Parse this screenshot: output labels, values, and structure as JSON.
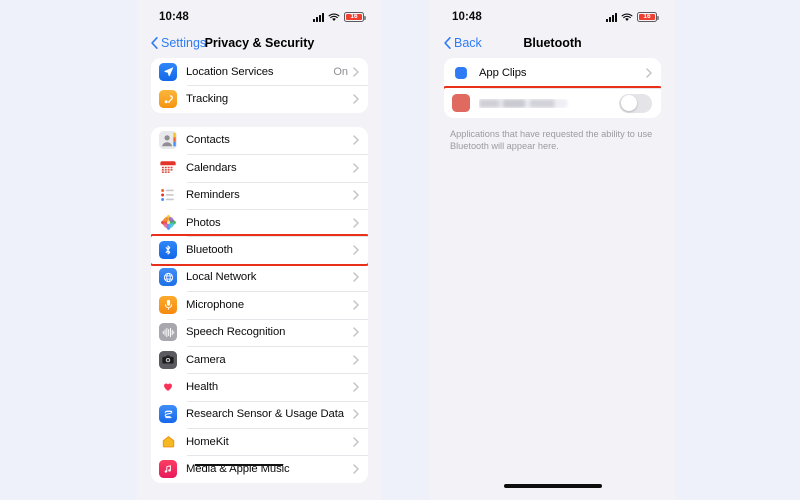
{
  "statusbar": {
    "time": "10:48",
    "battery_percent": "16",
    "cell_icon": "cellular-signal-icon",
    "wifi_icon": "wifi-icon",
    "battery_icon": "battery-low-icon"
  },
  "left_phone": {
    "nav": {
      "back_label": "Settings",
      "title": "Privacy & Security",
      "back_icon": "chevron-left-icon"
    },
    "group1": [
      {
        "label": "Location Services",
        "value": "On",
        "icon": "location-arrow-icon"
      },
      {
        "label": "Tracking",
        "value": "",
        "icon": "tracking-icon"
      }
    ],
    "group2": [
      {
        "label": "Contacts",
        "value": "",
        "icon": "contacts-icon"
      },
      {
        "label": "Calendars",
        "value": "",
        "icon": "calendar-icon"
      },
      {
        "label": "Reminders",
        "value": "",
        "icon": "reminders-icon"
      },
      {
        "label": "Photos",
        "value": "",
        "icon": "photos-icon"
      },
      {
        "label": "Bluetooth",
        "value": "",
        "icon": "bluetooth-icon",
        "highlighted": true
      },
      {
        "label": "Local Network",
        "value": "",
        "icon": "local-network-icon"
      },
      {
        "label": "Microphone",
        "value": "",
        "icon": "microphone-icon"
      },
      {
        "label": "Speech Recognition",
        "value": "",
        "icon": "speech-recognition-icon"
      },
      {
        "label": "Camera",
        "value": "",
        "icon": "camera-icon"
      },
      {
        "label": "Health",
        "value": "",
        "icon": "health-icon"
      },
      {
        "label": "Research Sensor & Usage Data",
        "value": "",
        "icon": "research-sensor-icon"
      },
      {
        "label": "HomeKit",
        "value": "",
        "icon": "homekit-icon"
      },
      {
        "label": "Media & Apple Music",
        "value": "",
        "icon": "media-apple-music-icon"
      }
    ]
  },
  "right_phone": {
    "nav": {
      "back_label": "Back",
      "title": "Bluetooth",
      "back_icon": "chevron-left-icon"
    },
    "rows": [
      {
        "label": "App Clips",
        "icon": "app-clips-icon",
        "control": "chevron"
      },
      {
        "label": "",
        "icon": "redacted-app-icon",
        "control": "toggle",
        "toggle_on": false,
        "redacted": true,
        "highlighted": true
      }
    ],
    "note": "Applications that have requested the ability to use Bluetooth will appear here."
  },
  "colors": {
    "page_background": "#eef1fa",
    "phone_background": "#f2f2f7",
    "accent_blue": "#2f7bf6",
    "highlight_red": "#e8301a",
    "secondary_text": "#8e8e93",
    "battery_red": "#f03e2f"
  }
}
